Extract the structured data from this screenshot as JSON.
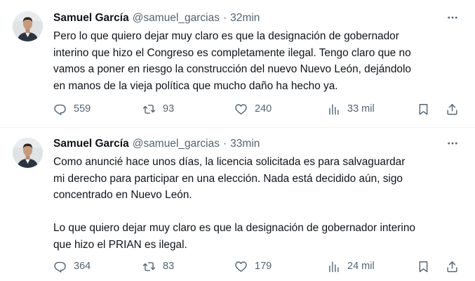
{
  "tweets": [
    {
      "author_name": "Samuel García",
      "handle": "@samuel_garcias",
      "separator": "·",
      "time": "32min",
      "more_icon": "ellipsis-icon",
      "lines": [
        "Pero lo que quiero dejar muy claro es que la designación de gobernador",
        "interino que hizo el Congreso es completamente ilegal. Tengo claro que no",
        "vamos a poner en riesgo la construcción del nuevo Nuevo León, dejándolo",
        "en manos de la vieja política que mucho daño ha hecho ya."
      ],
      "replies": "559",
      "retweets": "93",
      "likes": "240",
      "views": "33 mil"
    },
    {
      "author_name": "Samuel García",
      "handle": "@samuel_garcias",
      "separator": "·",
      "time": "33min",
      "more_icon": "ellipsis-icon",
      "lines_p1": [
        "Como anuncié hace unos días, la licencia solicitada es para salvaguardar",
        "mi derecho para participar en una elección. Nada está decidido aún, sigo",
        "concentrado en Nuevo León."
      ],
      "lines_p2": [
        "Lo que quiero dejar muy claro es que la designación de gobernador interino",
        "que hizo el PRIAN es ilegal."
      ],
      "replies": "364",
      "retweets": "83",
      "likes": "179",
      "views": "24 mil"
    }
  ],
  "colors": {
    "text": "#0f1419",
    "secondary": "#536471",
    "divider": "#eff3f4",
    "background": "#ffffff"
  }
}
